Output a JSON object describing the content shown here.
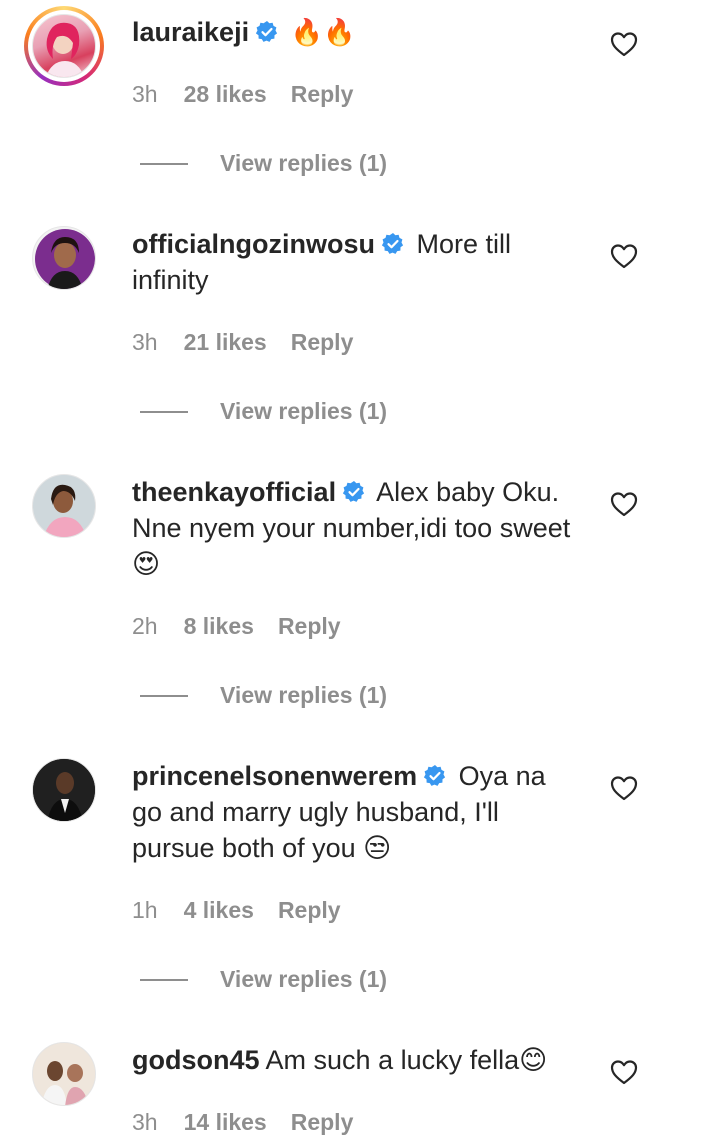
{
  "comments": [
    {
      "username": "lauraikeji",
      "text": "🔥🔥",
      "time": "3h",
      "likes": "28 likes",
      "reply": "Reply",
      "view_replies": "View replies (1)",
      "verified": true
    },
    {
      "username": "officialngozinwosu",
      "text": "More till infinity",
      "time": "3h",
      "likes": "21 likes",
      "reply": "Reply",
      "view_replies": "View replies (1)",
      "verified": true
    },
    {
      "username": "theenkayofficial",
      "text": "Alex baby Oku. Nne nyem your number,idi too sweet 😍",
      "time": "2h",
      "likes": "8 likes",
      "reply": "Reply",
      "view_replies": "View replies (1)",
      "verified": true
    },
    {
      "username": "princenelsonenwerem",
      "text": "Oya na go and marry ugly husband, I'll pursue both of you 😒",
      "time": "1h",
      "likes": "4 likes",
      "reply": "Reply",
      "view_replies": "View replies (1)",
      "verified": true
    },
    {
      "username": "godson45",
      "text": "Am such a lucky fella😊",
      "time": "3h",
      "likes": "14 likes",
      "reply": "Reply",
      "verified": false
    }
  ],
  "colors": {
    "text": "#262626",
    "muted": "#8e8e8e",
    "verified": "#3897f0"
  },
  "icons": {
    "like": "heart-outline-icon",
    "verified": "verified-badge-icon"
  }
}
